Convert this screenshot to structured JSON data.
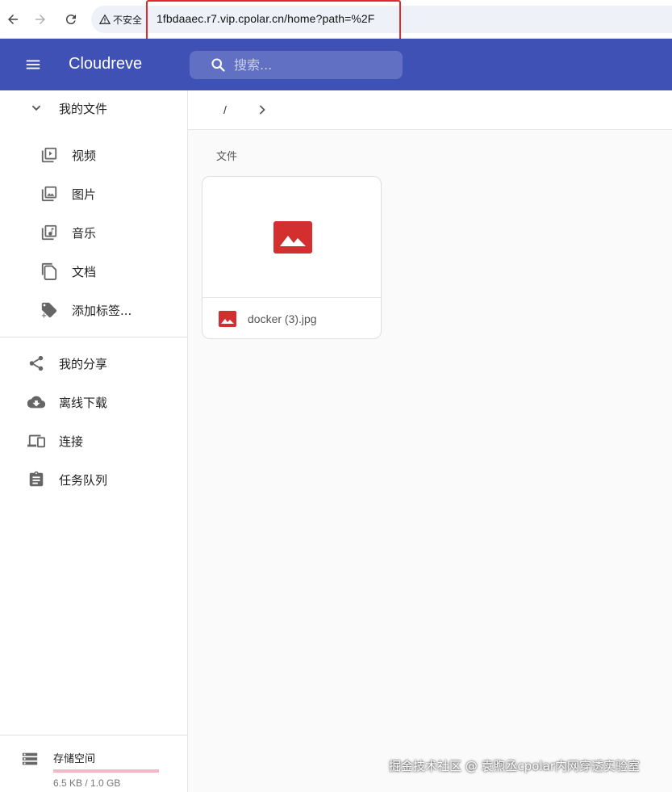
{
  "browser": {
    "security_label": "不安全",
    "url": "1fbdaaec.r7.vip.cpolar.cn/home?path=%2F"
  },
  "header": {
    "app_title": "Cloudreve",
    "search_placeholder": "搜索..."
  },
  "sidebar": {
    "my_files_label": "我的文件",
    "sub_items": [
      {
        "label": "视频",
        "icon": "video-icon"
      },
      {
        "label": "图片",
        "icon": "image-library-icon"
      },
      {
        "label": "音乐",
        "icon": "music-library-icon"
      },
      {
        "label": "文档",
        "icon": "document-icon"
      },
      {
        "label": "添加标签...",
        "icon": "add-tag-icon"
      }
    ],
    "items": [
      {
        "label": "我的分享",
        "icon": "share-icon"
      },
      {
        "label": "离线下载",
        "icon": "cloud-download-icon"
      },
      {
        "label": "连接",
        "icon": "devices-icon"
      },
      {
        "label": "任务队列",
        "icon": "clipboard-icon"
      }
    ],
    "storage": {
      "title": "存储空间",
      "usage": "6.5 KB / 1.0 GB",
      "used_fraction": 0.0
    }
  },
  "main": {
    "breadcrumb_root": "/",
    "section_title": "文件",
    "files": [
      {
        "name": "docker (3).jpg",
        "type": "image"
      }
    ]
  },
  "watermark": "掘金技术社区 @ 袁煦丞cpolar内网穿透实验室",
  "colors": {
    "primary": "#3f51b5",
    "image_icon_red": "#d32f2f",
    "storage_bar": "#f48fb1",
    "highlight": "#e0282e"
  }
}
